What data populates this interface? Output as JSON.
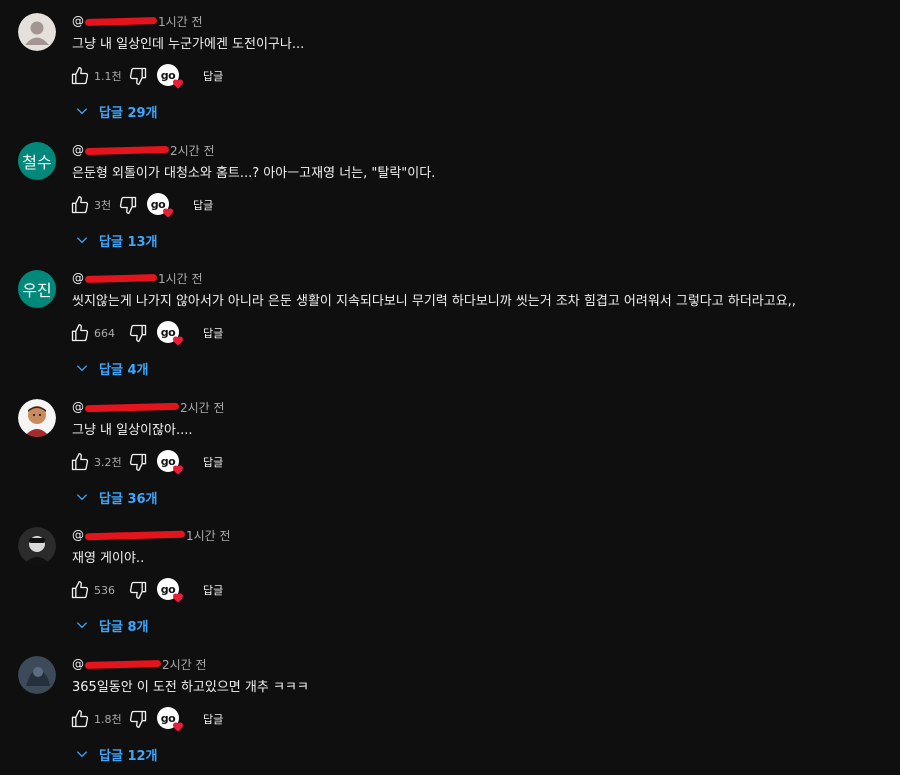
{
  "reply_label": "답글",
  "creator_badge": "go",
  "colors": {
    "background": "#0f0f0f",
    "text": "#f1f1f1",
    "muted": "#aaaaaa",
    "link": "#3ea6ff",
    "heart": "#e91e3a"
  },
  "icons": {
    "like": "thumb-up-icon",
    "dislike": "thumb-down-icon",
    "heart": "heart-icon",
    "expand": "chevron-down-icon"
  },
  "comments": [
    {
      "avatar_type": "photo",
      "avatar_letter": "",
      "handle": "@",
      "time": "1시간 전",
      "text": "그냥 내 일상인데 누군가에겐 도전이구나...",
      "likes": "1.1천",
      "replies": "답글 29개"
    },
    {
      "avatar_type": "letter",
      "avatar_letter": "철수",
      "handle": "@",
      "time": "2시간 전",
      "text": "은둔형 외톨이가 대청소와 홈트...? 아아ㅡ고재영 너는, \"탈락\"이다.",
      "likes": "3천",
      "replies": "답글 13개"
    },
    {
      "avatar_type": "letter",
      "avatar_letter": "우진",
      "handle": "@",
      "time": "1시간 전",
      "text": "씻지않는게 나가지 않아서가 아니라 은둔 생활이 지속되다보니 무기력 하다보니까 씻는거 조차 힘겹고 어려워서 그렇다고 하더라고요,,",
      "likes": "664",
      "replies": "답글 4개"
    },
    {
      "avatar_type": "photo",
      "avatar_letter": "",
      "handle": "@",
      "time": "2시간 전",
      "text": "그냥 내 일상이잖아....",
      "likes": "3.2천",
      "replies": "답글 36개"
    },
    {
      "avatar_type": "photo",
      "avatar_letter": "",
      "handle": "@",
      "time": "1시간 전",
      "text": "재영 게이야..",
      "likes": "536",
      "replies": "답글 8개"
    },
    {
      "avatar_type": "photo",
      "avatar_letter": "",
      "handle": "@",
      "time": "2시간 전",
      "text": "365일동안 이 도전 하고있으면 개추 ㅋㅋㅋ",
      "likes": "1.8천",
      "replies": "답글 12개"
    }
  ]
}
